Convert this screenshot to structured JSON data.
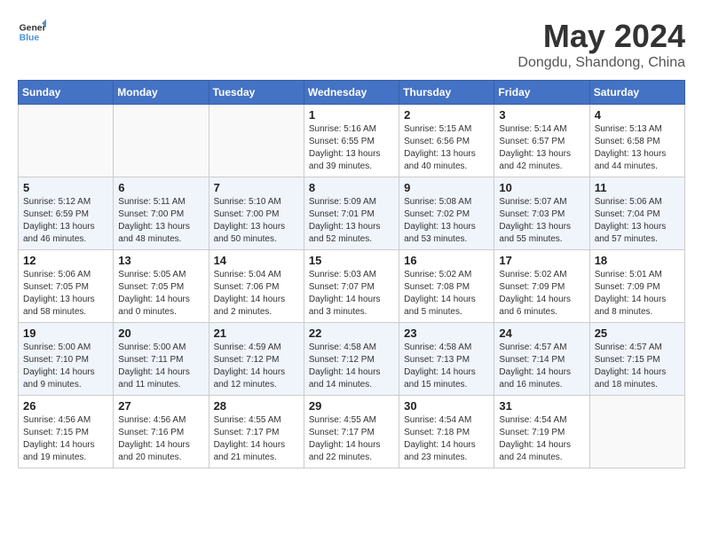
{
  "header": {
    "logo_general": "General",
    "logo_blue": "Blue",
    "month_year": "May 2024",
    "location": "Dongdu, Shandong, China"
  },
  "days_of_week": [
    "Sunday",
    "Monday",
    "Tuesday",
    "Wednesday",
    "Thursday",
    "Friday",
    "Saturday"
  ],
  "weeks": [
    [
      {
        "day": "",
        "content": ""
      },
      {
        "day": "",
        "content": ""
      },
      {
        "day": "",
        "content": ""
      },
      {
        "day": "1",
        "content": "Sunrise: 5:16 AM\nSunset: 6:55 PM\nDaylight: 13 hours\nand 39 minutes."
      },
      {
        "day": "2",
        "content": "Sunrise: 5:15 AM\nSunset: 6:56 PM\nDaylight: 13 hours\nand 40 minutes."
      },
      {
        "day": "3",
        "content": "Sunrise: 5:14 AM\nSunset: 6:57 PM\nDaylight: 13 hours\nand 42 minutes."
      },
      {
        "day": "4",
        "content": "Sunrise: 5:13 AM\nSunset: 6:58 PM\nDaylight: 13 hours\nand 44 minutes."
      }
    ],
    [
      {
        "day": "5",
        "content": "Sunrise: 5:12 AM\nSunset: 6:59 PM\nDaylight: 13 hours\nand 46 minutes."
      },
      {
        "day": "6",
        "content": "Sunrise: 5:11 AM\nSunset: 7:00 PM\nDaylight: 13 hours\nand 48 minutes."
      },
      {
        "day": "7",
        "content": "Sunrise: 5:10 AM\nSunset: 7:00 PM\nDaylight: 13 hours\nand 50 minutes."
      },
      {
        "day": "8",
        "content": "Sunrise: 5:09 AM\nSunset: 7:01 PM\nDaylight: 13 hours\nand 52 minutes."
      },
      {
        "day": "9",
        "content": "Sunrise: 5:08 AM\nSunset: 7:02 PM\nDaylight: 13 hours\nand 53 minutes."
      },
      {
        "day": "10",
        "content": "Sunrise: 5:07 AM\nSunset: 7:03 PM\nDaylight: 13 hours\nand 55 minutes."
      },
      {
        "day": "11",
        "content": "Sunrise: 5:06 AM\nSunset: 7:04 PM\nDaylight: 13 hours\nand 57 minutes."
      }
    ],
    [
      {
        "day": "12",
        "content": "Sunrise: 5:06 AM\nSunset: 7:05 PM\nDaylight: 13 hours\nand 58 minutes."
      },
      {
        "day": "13",
        "content": "Sunrise: 5:05 AM\nSunset: 7:05 PM\nDaylight: 14 hours\nand 0 minutes."
      },
      {
        "day": "14",
        "content": "Sunrise: 5:04 AM\nSunset: 7:06 PM\nDaylight: 14 hours\nand 2 minutes."
      },
      {
        "day": "15",
        "content": "Sunrise: 5:03 AM\nSunset: 7:07 PM\nDaylight: 14 hours\nand 3 minutes."
      },
      {
        "day": "16",
        "content": "Sunrise: 5:02 AM\nSunset: 7:08 PM\nDaylight: 14 hours\nand 5 minutes."
      },
      {
        "day": "17",
        "content": "Sunrise: 5:02 AM\nSunset: 7:09 PM\nDaylight: 14 hours\nand 6 minutes."
      },
      {
        "day": "18",
        "content": "Sunrise: 5:01 AM\nSunset: 7:09 PM\nDaylight: 14 hours\nand 8 minutes."
      }
    ],
    [
      {
        "day": "19",
        "content": "Sunrise: 5:00 AM\nSunset: 7:10 PM\nDaylight: 14 hours\nand 9 minutes."
      },
      {
        "day": "20",
        "content": "Sunrise: 5:00 AM\nSunset: 7:11 PM\nDaylight: 14 hours\nand 11 minutes."
      },
      {
        "day": "21",
        "content": "Sunrise: 4:59 AM\nSunset: 7:12 PM\nDaylight: 14 hours\nand 12 minutes."
      },
      {
        "day": "22",
        "content": "Sunrise: 4:58 AM\nSunset: 7:12 PM\nDaylight: 14 hours\nand 14 minutes."
      },
      {
        "day": "23",
        "content": "Sunrise: 4:58 AM\nSunset: 7:13 PM\nDaylight: 14 hours\nand 15 minutes."
      },
      {
        "day": "24",
        "content": "Sunrise: 4:57 AM\nSunset: 7:14 PM\nDaylight: 14 hours\nand 16 minutes."
      },
      {
        "day": "25",
        "content": "Sunrise: 4:57 AM\nSunset: 7:15 PM\nDaylight: 14 hours\nand 18 minutes."
      }
    ],
    [
      {
        "day": "26",
        "content": "Sunrise: 4:56 AM\nSunset: 7:15 PM\nDaylight: 14 hours\nand 19 minutes."
      },
      {
        "day": "27",
        "content": "Sunrise: 4:56 AM\nSunset: 7:16 PM\nDaylight: 14 hours\nand 20 minutes."
      },
      {
        "day": "28",
        "content": "Sunrise: 4:55 AM\nSunset: 7:17 PM\nDaylight: 14 hours\nand 21 minutes."
      },
      {
        "day": "29",
        "content": "Sunrise: 4:55 AM\nSunset: 7:17 PM\nDaylight: 14 hours\nand 22 minutes."
      },
      {
        "day": "30",
        "content": "Sunrise: 4:54 AM\nSunset: 7:18 PM\nDaylight: 14 hours\nand 23 minutes."
      },
      {
        "day": "31",
        "content": "Sunrise: 4:54 AM\nSunset: 7:19 PM\nDaylight: 14 hours\nand 24 minutes."
      },
      {
        "day": "",
        "content": ""
      }
    ]
  ]
}
